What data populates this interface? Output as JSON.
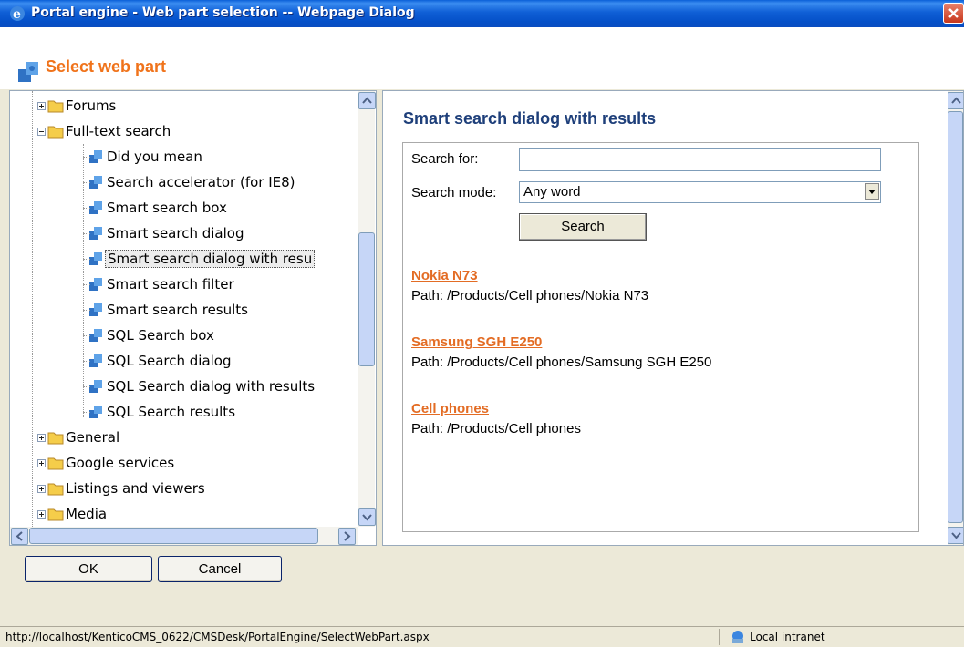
{
  "window": {
    "title": "Portal engine - Web part selection -- Webpage Dialog"
  },
  "header": {
    "title": "Select web part"
  },
  "tree": {
    "items": [
      {
        "label": "Forums",
        "type": "folder"
      },
      {
        "label": "Full-text search",
        "type": "folder"
      },
      {
        "label": "Did you mean",
        "type": "webpart"
      },
      {
        "label": "Search accelerator (for IE8)",
        "type": "webpart"
      },
      {
        "label": "Smart search box",
        "type": "webpart"
      },
      {
        "label": "Smart search dialog",
        "type": "webpart"
      },
      {
        "label": "Smart search dialog with resu",
        "type": "webpart",
        "selected": true
      },
      {
        "label": "Smart search filter",
        "type": "webpart"
      },
      {
        "label": "Smart search results",
        "type": "webpart"
      },
      {
        "label": "SQL Search box",
        "type": "webpart"
      },
      {
        "label": "SQL Search dialog",
        "type": "webpart"
      },
      {
        "label": "SQL Search dialog with results",
        "type": "webpart"
      },
      {
        "label": "SQL Search results",
        "type": "webpart"
      },
      {
        "label": "General",
        "type": "folder"
      },
      {
        "label": "Google services",
        "type": "folder"
      },
      {
        "label": "Listings and viewers",
        "type": "folder"
      },
      {
        "label": "Media",
        "type": "folder"
      }
    ]
  },
  "preview": {
    "title": "Smart search dialog with results",
    "search_for_label": "Search for:",
    "search_for_value": "",
    "search_mode_label": "Search mode:",
    "search_mode_value": "Any word",
    "search_button": "Search",
    "results": [
      {
        "title": "Nokia N73",
        "path": "Path: /Products/Cell phones/Nokia N73"
      },
      {
        "title": "Samsung SGH E250",
        "path": "Path: /Products/Cell phones/Samsung SGH E250"
      },
      {
        "title": "Cell phones",
        "path": "Path: /Products/Cell phones"
      }
    ]
  },
  "footer": {
    "ok": "OK",
    "cancel": "Cancel"
  },
  "status": {
    "url": "http://localhost/KenticoCMS_0622/CMSDesk/PortalEngine/SelectWebPart.aspx",
    "zone": "Local intranet"
  },
  "colors": {
    "accent": "#f0731b",
    "title_blue": "#1e3f7a",
    "link": "#e36c24"
  }
}
